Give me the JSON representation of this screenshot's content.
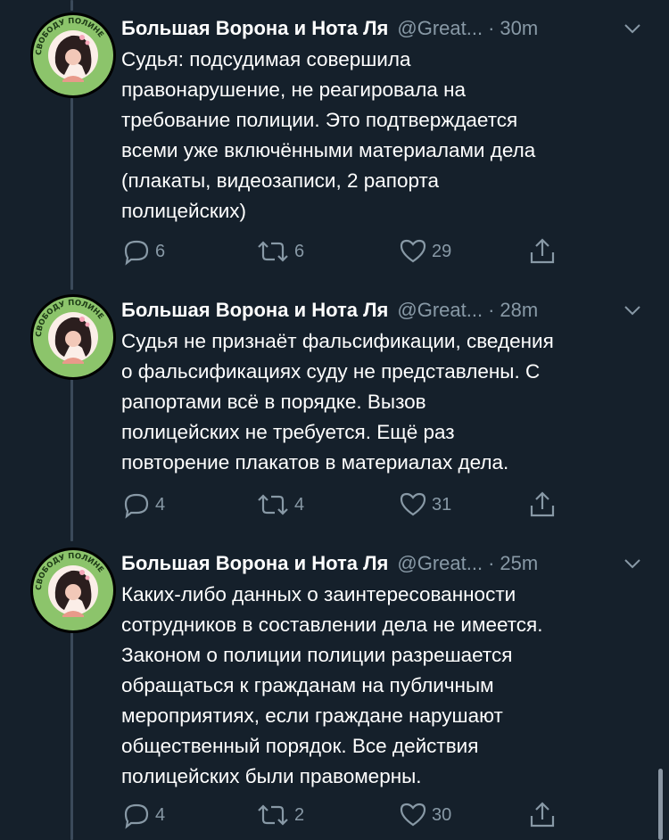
{
  "colors": {
    "background": "#15202b",
    "primary_text": "#ffffff",
    "secondary_text": "#8899a6",
    "thread_line": "#3b4a5a",
    "avatar_badge": "#8cc46b"
  },
  "tweets": [
    {
      "author_name": "Большая Ворона и Нота Ля",
      "handle": "@Great...",
      "separator": "·",
      "time": "30m",
      "avatar_badge_text": "СВОБОДУ ПОЛИНЕ",
      "lines": [
        "Судья: подсудимая совершила",
        "правонарушение, не реагировала на",
        "требование полиции. Это подтверждается",
        "всеми уже включёнными материалами дела",
        "(плакаты, видеозаписи, 2 рапорта",
        "полицейских)"
      ],
      "replies": "6",
      "retweets": "6",
      "likes": "29",
      "icons": [
        "reply-icon",
        "retweet-icon",
        "like-icon",
        "share-icon",
        "chevron-down-icon"
      ]
    },
    {
      "author_name": "Большая Ворона и Нота Ля",
      "handle": "@Great...",
      "separator": "·",
      "time": "28m",
      "avatar_badge_text": "СВОБОДУ ПОЛИНЕ",
      "lines": [
        "Судья не признаёт фальсификации, сведения",
        "о фальсификациях суду не представлены. С",
        "рапортами всё в порядке. Вызов",
        "полицейских не требуется. Ещё раз",
        "повторение плакатов в материалах дела."
      ],
      "replies": "4",
      "retweets": "4",
      "likes": "31",
      "icons": [
        "reply-icon",
        "retweet-icon",
        "like-icon",
        "share-icon",
        "chevron-down-icon"
      ]
    },
    {
      "author_name": "Большая Ворона и Нота Ля",
      "handle": "@Great...",
      "separator": "·",
      "time": "25m",
      "avatar_badge_text": "СВОБОДУ ПОЛИНЕ",
      "lines": [
        "Каких-либо данных о заинтересованности",
        "сотрудников в составлении дела не имеется.",
        "Законом о полиции полиции разрешается",
        "обращаться к гражданам на публичным",
        "мероприятиях, если граждане нарушают",
        "общественный порядок. Все действия",
        "полицейских были правомерны."
      ],
      "replies": "4",
      "retweets": "2",
      "likes": "30",
      "icons": [
        "reply-icon",
        "retweet-icon",
        "like-icon",
        "share-icon",
        "chevron-down-icon"
      ]
    }
  ]
}
